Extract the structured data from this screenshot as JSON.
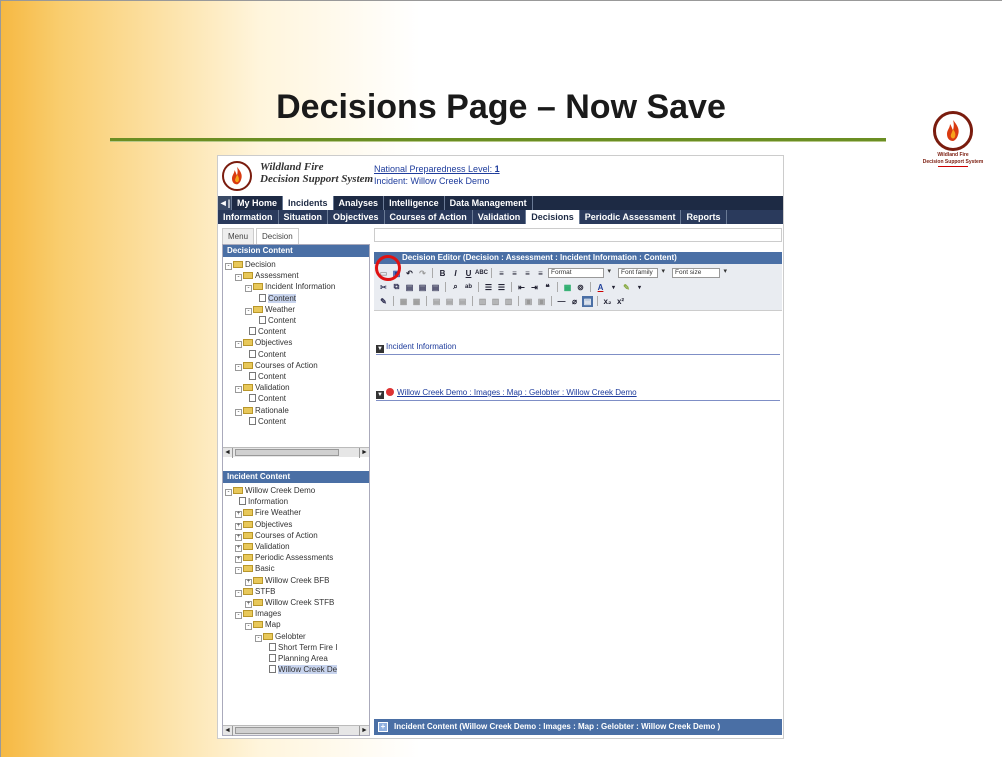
{
  "slide": {
    "title": "Decisions Page – Now Save",
    "logo_caption_1": "Wildland Fire",
    "logo_caption_2": "Decision Support System"
  },
  "app": {
    "name_line1": "Wildland Fire",
    "name_line2": "Decision Support System",
    "npl_label": "National Preparedness Level:",
    "npl_value": "1",
    "incident_line": "Incident: Willow Creek Demo"
  },
  "nav_main": {
    "collapse": "◄|",
    "tabs": [
      "My Home",
      "Incidents",
      "Analyses",
      "Intelligence",
      "Data Management"
    ]
  },
  "nav_sub": {
    "tabs": [
      "Information",
      "Situation",
      "Objectives",
      "Courses of Action",
      "Validation",
      "Decisions",
      "Periodic Assessment",
      "Reports"
    ]
  },
  "left_tabs": [
    "Menu",
    "Decision"
  ],
  "decision_content": {
    "header": "Decision Content",
    "items": [
      "Decision",
      "Assessment",
      "Incident Information",
      "Content",
      "Weather",
      "Content",
      "Content",
      "Objectives",
      "Content",
      "Courses of Action",
      "Content",
      "Validation",
      "Content",
      "Rationale",
      "Content"
    ]
  },
  "incident_content": {
    "header": "Incident Content",
    "items": [
      "Willow Creek Demo",
      "Information",
      "Fire Weather",
      "Objectives",
      "Courses of Action",
      "Validation",
      "Periodic Assessments",
      "Basic",
      "Willow Creek BFB",
      "STFB",
      "Willow Creek STFB",
      "Images",
      "Map",
      "Gelobter",
      "Short Term Fire I",
      "Planning Area",
      "Willow Creek De"
    ]
  },
  "editor": {
    "header": "Decision Editor (Decision : Assessment : Incident Information : Content)",
    "format": "Format",
    "font_family": "Font family",
    "font_size": "Font size",
    "section_title": "Incident Information",
    "link_text": "Willow Creek Demo : Images : Map : Gelobter : Willow Creek Demo"
  },
  "bottom_bar": "Incident Content (Willow Creek Demo : Images : Map : Gelobter : Willow Creek Demo )",
  "colors": {
    "accent_navy": "#1d2a44",
    "panel_blue": "#4a6fa5",
    "highlight_red": "#e01212",
    "rule_green": "#6b8e23"
  }
}
